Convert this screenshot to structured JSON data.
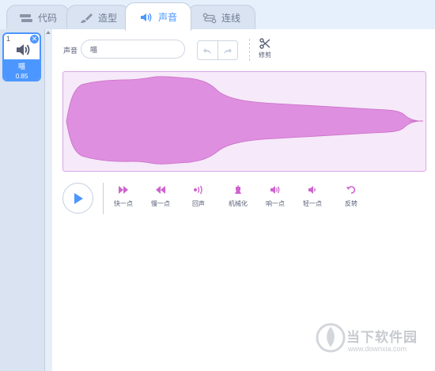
{
  "tabs": [
    {
      "label": "代码",
      "icon": "code-icon"
    },
    {
      "label": "造型",
      "icon": "brush-icon"
    },
    {
      "label": "声音",
      "icon": "speaker-icon",
      "active": true
    },
    {
      "label": "连线",
      "icon": "connect-icon"
    }
  ],
  "sound_list": {
    "items": [
      {
        "index": "1",
        "name": "喵",
        "duration": "0.85",
        "selected": true
      }
    ]
  },
  "editor": {
    "sound_label": "声音",
    "sound_name": "喵",
    "trim_label": "修剪"
  },
  "effects": [
    {
      "label": "快一点",
      "icon": "fast-forward-icon"
    },
    {
      "label": "慢一点",
      "icon": "rewind-icon"
    },
    {
      "label": "回声",
      "icon": "echo-icon"
    },
    {
      "label": "机械化",
      "icon": "robot-icon"
    },
    {
      "label": "响一点",
      "icon": "louder-icon"
    },
    {
      "label": "轻一点",
      "icon": "softer-icon"
    },
    {
      "label": "反转",
      "icon": "reverse-icon"
    }
  ],
  "colors": {
    "accent": "#4c97ff",
    "effect": "#cf63cf",
    "waveform_fill": "#df8fdf",
    "waveform_bg": "#f6e9f9"
  },
  "watermark": {
    "title": "当下软件园",
    "url": "www.downxia.com"
  }
}
